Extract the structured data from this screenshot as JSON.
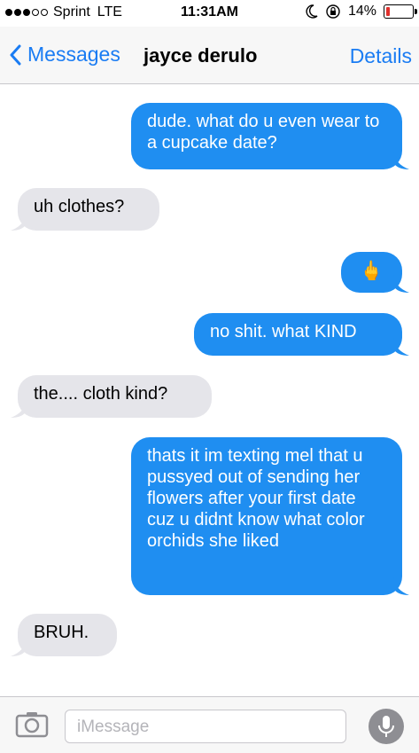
{
  "status_bar": {
    "carrier": "Sprint",
    "network": "LTE",
    "time": "11:31AM",
    "battery_percent": "14%",
    "battery_level": 0.14
  },
  "nav": {
    "back_label": "Messages",
    "contact_name": "jayce derulo",
    "details_label": "Details"
  },
  "messages": [
    {
      "from": "me",
      "text": "dude. what do u even wear to a cupcake date?"
    },
    {
      "from": "them",
      "text": "uh clothes?"
    },
    {
      "from": "me",
      "text": "🖕"
    },
    {
      "from": "me",
      "text": "no shit. what KIND"
    },
    {
      "from": "them",
      "text": "the.... cloth kind?"
    },
    {
      "from": "me",
      "text": "thats it im texting mel that u pussyed out of sending her flowers after your first date cuz u didnt know what color orchids she liked"
    },
    {
      "from": "them",
      "text": "BRUH."
    }
  ],
  "input": {
    "placeholder": "iMessage"
  },
  "colors": {
    "accent": "#1a7cf3",
    "outgoing_bubble": "#1f8ef1",
    "incoming_bubble": "#e5e5ea"
  }
}
